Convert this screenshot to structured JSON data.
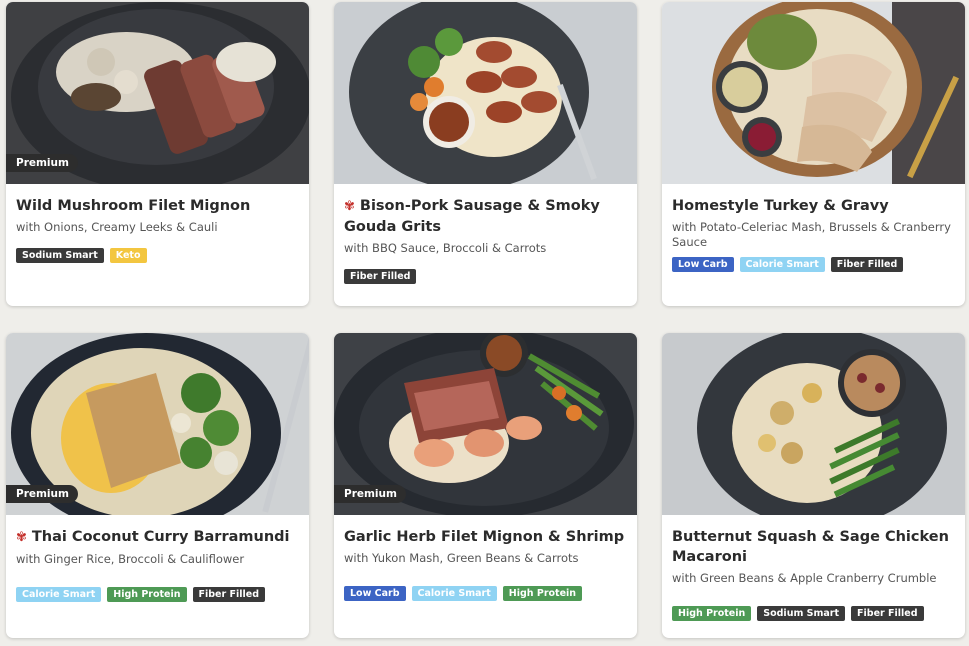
{
  "meals": [
    {
      "premium": "Premium",
      "spicy": false,
      "title": "Wild Mushroom Filet Mignon",
      "subtitle": "with Onions, Creamy Leeks & Cauli",
      "tags": [
        {
          "label": "Sodium Smart",
          "kind": "sodium"
        },
        {
          "label": "Keto",
          "kind": "keto"
        }
      ]
    },
    {
      "premium": "",
      "spicy": true,
      "title": "Bison-Pork Sausage & Smoky Gouda Grits",
      "subtitle": "with BBQ Sauce, Broccoli & Carrots",
      "tags": [
        {
          "label": "Fiber Filled",
          "kind": "fiber"
        }
      ]
    },
    {
      "premium": "",
      "spicy": false,
      "title": "Homestyle Turkey & Gravy",
      "subtitle": "with Potato-Celeriac Mash, Brussels & Cranberry Sauce",
      "tags": [
        {
          "label": "Low Carb",
          "kind": "lowcarb"
        },
        {
          "label": "Calorie Smart",
          "kind": "calorie"
        },
        {
          "label": "Fiber Filled",
          "kind": "fiber"
        }
      ]
    },
    {
      "premium": "Premium",
      "spicy": true,
      "title": "Thai Coconut Curry Barramundi",
      "subtitle": "with Ginger Rice, Broccoli & Cauliflower",
      "tags": [
        {
          "label": "Calorie Smart",
          "kind": "calorie"
        },
        {
          "label": "High Protein",
          "kind": "protein"
        },
        {
          "label": "Fiber Filled",
          "kind": "fiber"
        }
      ]
    },
    {
      "premium": "Premium",
      "spicy": false,
      "title": "Garlic Herb Filet Mignon & Shrimp",
      "subtitle": "with Yukon Mash, Green Beans & Carrots",
      "tags": [
        {
          "label": "Low Carb",
          "kind": "lowcarb"
        },
        {
          "label": "Calorie Smart",
          "kind": "calorie"
        },
        {
          "label": "High Protein",
          "kind": "protein"
        }
      ]
    },
    {
      "premium": "",
      "spicy": false,
      "title": "Butternut Squash & Sage Chicken Macaroni",
      "subtitle": "with Green Beans & Apple Cranberry Crumble",
      "tags": [
        {
          "label": "High Protein",
          "kind": "protein"
        },
        {
          "label": "Sodium Smart",
          "kind": "sodium"
        },
        {
          "label": "Fiber Filled",
          "kind": "fiber"
        }
      ]
    }
  ],
  "colors": {
    "accent_spicy": "#c4302b",
    "tag_low_carb": "#3c64c4",
    "tag_calorie_smart": "#8fd3f3",
    "tag_high_protein": "#4e9a55",
    "tag_keto": "#f3c640",
    "tag_dark": "#3a3a3a"
  },
  "icons": {
    "spicy": "chili-pepper-icon"
  }
}
